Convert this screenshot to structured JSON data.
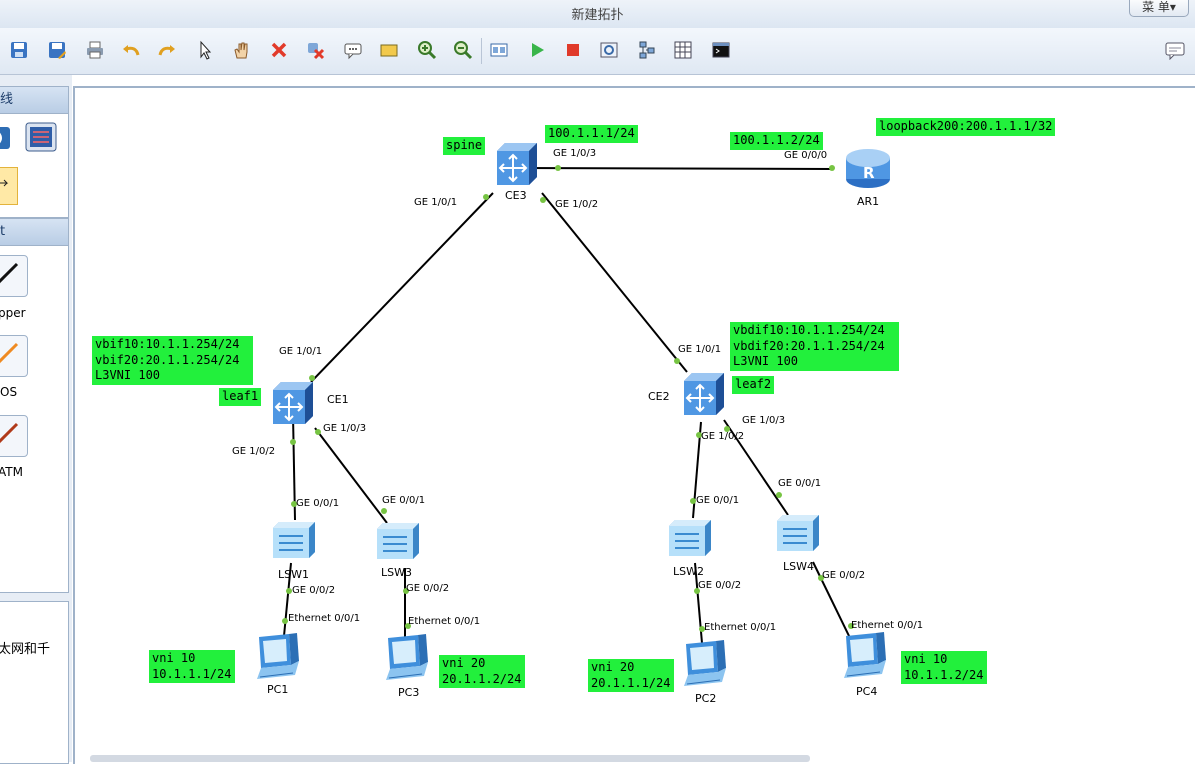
{
  "window": {
    "title": "新建拓扑",
    "menu_label": "菜 单▾"
  },
  "toolbar": {
    "items": [
      "save-icon",
      "save-as-icon",
      "print-icon",
      "undo-icon",
      "redo-icon",
      "select-icon",
      "pan-icon",
      "delete-icon",
      "delete-link-icon",
      "text-icon",
      "rectangle-icon",
      "zoom-in-icon",
      "zoom-out-icon",
      "topology-icon",
      "start-icon",
      "stop-icon",
      "capture-icon",
      "layout-icon",
      "grid-icon",
      "cli-icon",
      "chat-icon"
    ]
  },
  "sidebar": {
    "panel1_title": "线",
    "panel2_title": "t",
    "cables": [
      "pper",
      "OS",
      "ATM"
    ],
    "desc_text": "太网和千"
  },
  "topology": {
    "devices": [
      {
        "id": "CE3",
        "name": "CE3",
        "kind": "switch-ce"
      },
      {
        "id": "AR1",
        "name": "AR1",
        "kind": "router"
      },
      {
        "id": "CE1",
        "name": "CE1",
        "kind": "switch-ce"
      },
      {
        "id": "CE2",
        "name": "CE2",
        "kind": "switch-ce"
      },
      {
        "id": "LSW1",
        "name": "LSW1",
        "kind": "switch-l2"
      },
      {
        "id": "LSW3",
        "name": "LSW3",
        "kind": "switch-l2"
      },
      {
        "id": "LSW2",
        "name": "LSW2",
        "kind": "switch-l2"
      },
      {
        "id": "LSW4",
        "name": "LSW4",
        "kind": "switch-l2"
      },
      {
        "id": "PC1",
        "name": "PC1",
        "kind": "pc"
      },
      {
        "id": "PC3",
        "name": "PC3",
        "kind": "pc"
      },
      {
        "id": "PC2",
        "name": "PC2",
        "kind": "pc"
      },
      {
        "id": "PC4",
        "name": "PC4",
        "kind": "pc"
      }
    ],
    "links": [
      {
        "a": "CE3",
        "a_port": "GE 1/0/3",
        "b": "AR1",
        "b_port": "GE 0/0/0"
      },
      {
        "a": "CE3",
        "a_port": "GE 1/0/1",
        "b": "CE1",
        "b_port": "GE 1/0/1"
      },
      {
        "a": "CE3",
        "a_port": "GE 1/0/2",
        "b": "CE2",
        "b_port": "GE 1/0/1"
      },
      {
        "a": "CE1",
        "a_port": "GE 1/0/2",
        "b": "LSW1",
        "b_port": "GE 0/0/1"
      },
      {
        "a": "CE1",
        "a_port": "GE 1/0/3",
        "b": "LSW3",
        "b_port": "GE 0/0/1"
      },
      {
        "a": "CE2",
        "a_port": "GE 1/0/2",
        "b": "LSW2",
        "b_port": "GE 0/0/1"
      },
      {
        "a": "CE2",
        "a_port": "GE 1/0/3",
        "b": "LSW4",
        "b_port": "GE 0/0/1"
      },
      {
        "a": "LSW1",
        "a_port": "GE 0/0/2",
        "b": "PC1",
        "b_port": "Ethernet 0/0/1"
      },
      {
        "a": "LSW3",
        "a_port": "GE 0/0/2",
        "b": "PC3",
        "b_port": "Ethernet 0/0/1"
      },
      {
        "a": "LSW2",
        "a_port": "GE 0/0/2",
        "b": "PC2",
        "b_port": "Ethernet 0/0/1"
      },
      {
        "a": "LSW4",
        "a_port": "GE 0/0/2",
        "b": "PC4",
        "b_port": "Ethernet 0/0/1"
      }
    ],
    "notes": {
      "spine": "spine",
      "ce3_ip": "100.1.1.1/24",
      "ar1_ip": "100.1.1.2/24",
      "loopback": "loopback200:200.1.1.1/32",
      "leaf1": "leaf1",
      "leaf1_cfg": "vbif10:10.1.1.254/24\nvbif20:20.1.1.254/24\nL3VNI 100",
      "leaf2": "leaf2",
      "leaf2_cfg": "vbdif10:10.1.1.254/24\nvbdif20:20.1.1.254/24\nL3VNI 100",
      "pc1": "vni 10\n10.1.1.1/24",
      "pc3": "vni 20\n20.1.1.2/24",
      "pc2": "vni 20\n20.1.1.1/24",
      "pc4": "vni 10\n10.1.1.2/24"
    }
  },
  "colors": {
    "label_bg": "#22f03c",
    "link": "#000000",
    "port_dot": "#77c443",
    "device_blue": "#3d86d6"
  }
}
